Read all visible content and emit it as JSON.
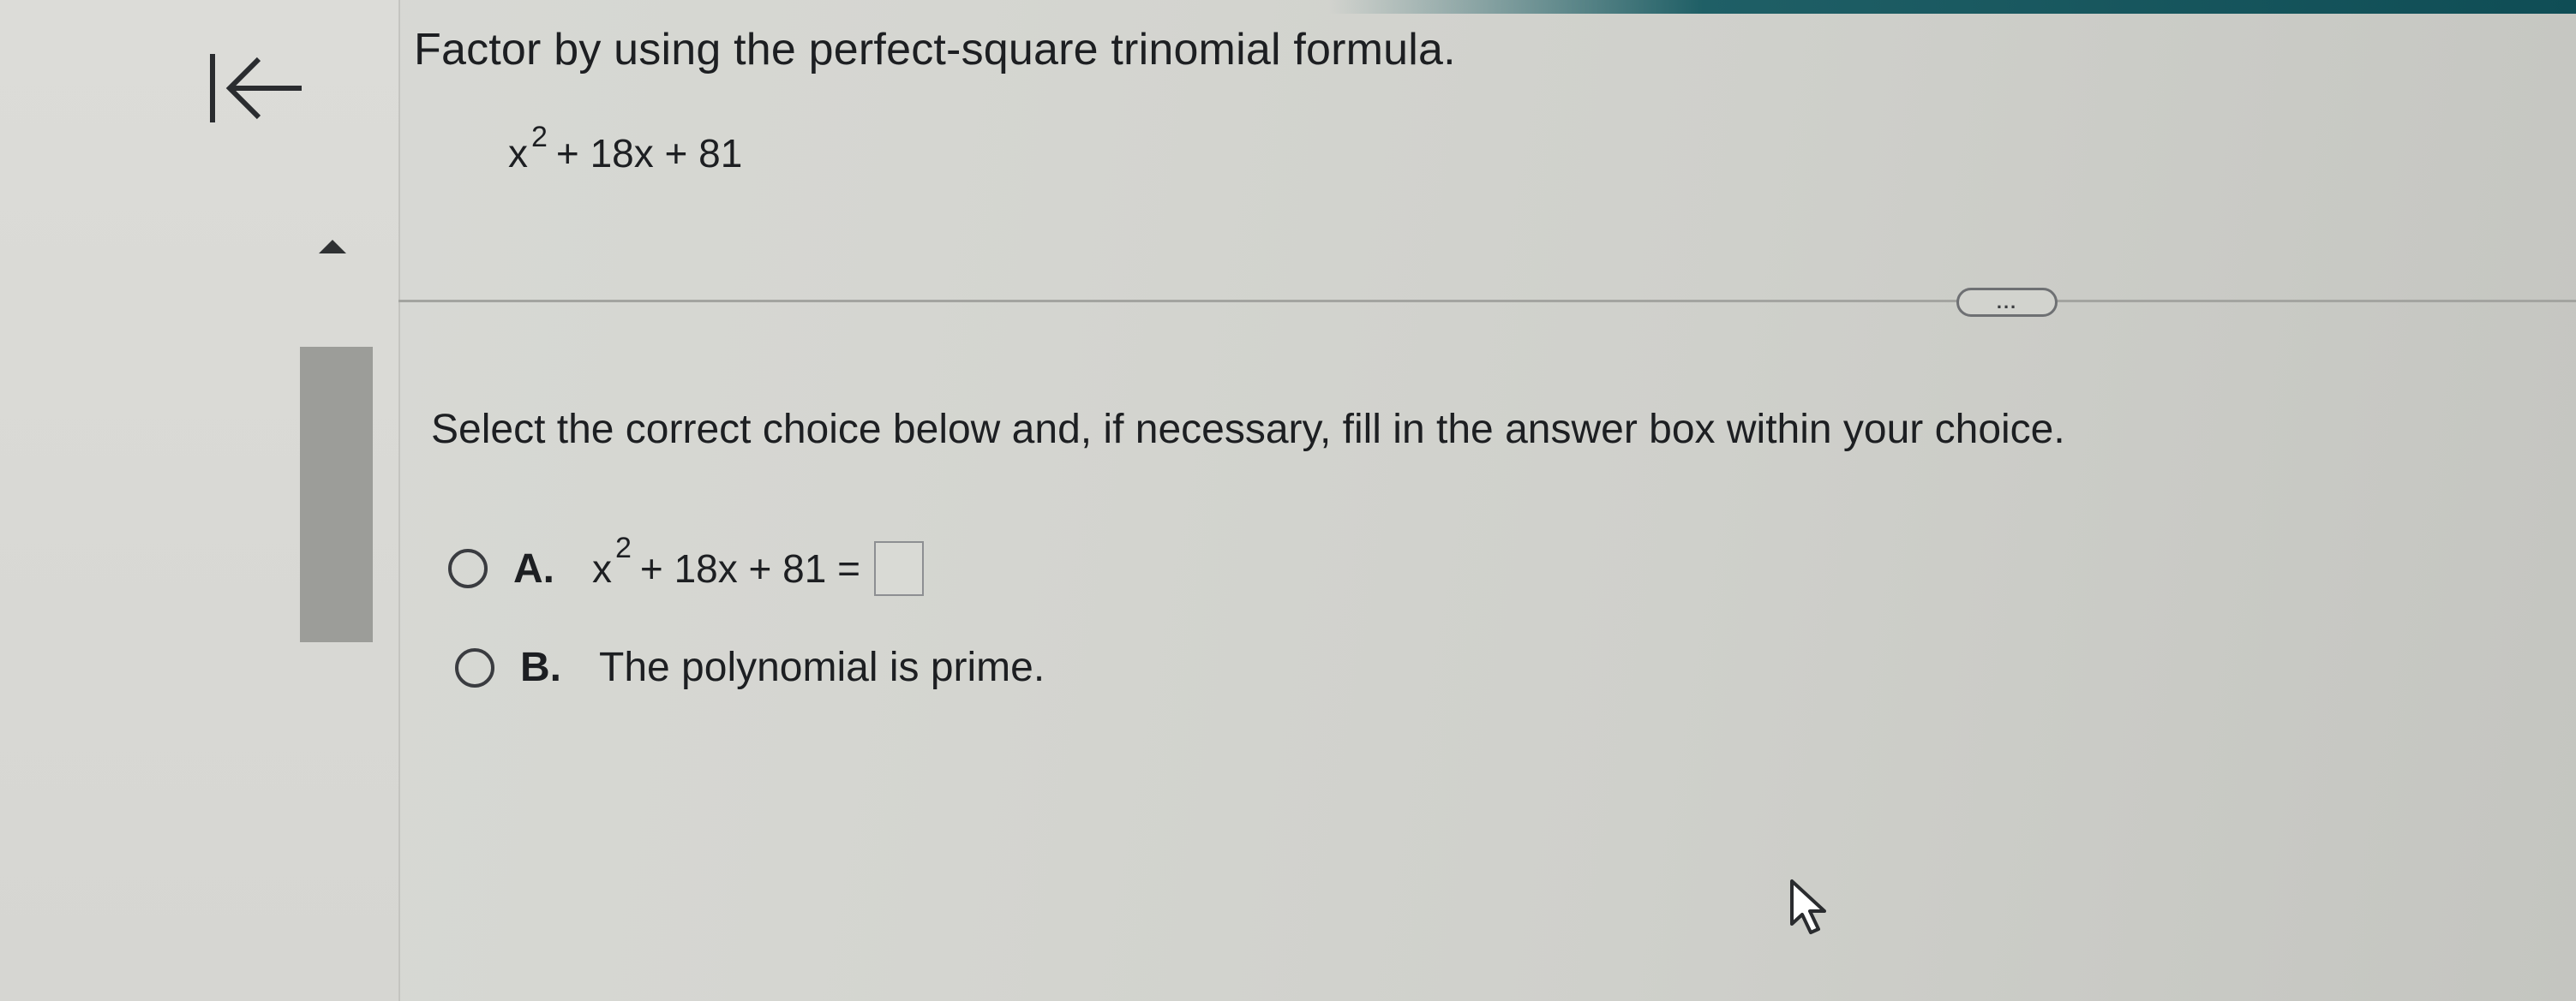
{
  "question": {
    "prompt": "Factor by using the perfect-square trinomial formula.",
    "expression": {
      "base": "x",
      "exponent": "2",
      "rest": "+ 18x + 81"
    }
  },
  "instructions": "Select the correct choice below and, if necessary, fill in the answer box within your choice.",
  "more_button": "...",
  "choices": [
    {
      "letter": "A.",
      "expression": {
        "base": "x",
        "exponent": "2",
        "rest": "+ 18x + 81 ="
      },
      "answer_value": ""
    },
    {
      "letter": "B.",
      "text": "The polynomial is prime."
    }
  ],
  "icons": {
    "back": "back-to-start-icon",
    "scroll_up": "scroll-up-arrow-icon",
    "cursor": "mouse-pointer-icon"
  },
  "colors": {
    "header_strip": "#0f4d55",
    "text": "#1d1f22",
    "scroll_thumb": "#9c9d99"
  }
}
